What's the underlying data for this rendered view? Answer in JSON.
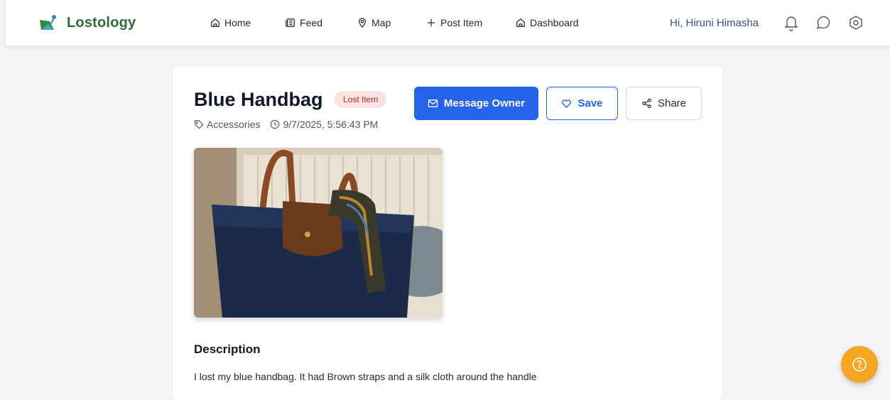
{
  "header": {
    "brand_name": "Lostology",
    "nav": {
      "home": "Home",
      "feed": "Feed",
      "map": "Map",
      "post_item": "Post Item",
      "dashboard": "Dashboard"
    },
    "greeting": "Hi, Hiruni Himasha",
    "icons": [
      "bell-icon",
      "chat-icon",
      "settings-icon"
    ]
  },
  "item": {
    "title": "Blue Handbag",
    "status_badge": "Lost Item",
    "category": "Accessories",
    "timestamp": "9/7/2025, 5:56:43 PM",
    "actions": {
      "message_owner": "Message Owner",
      "save": "Save",
      "share": "Share"
    },
    "photo_alt": "Blue Handbag",
    "description_heading": "Description",
    "description_text": "I lost my blue handbag. It had Brown straps and a silk cloth around the handle"
  },
  "colors": {
    "brand": "#2f6b3b",
    "primary": "#2563eb",
    "badge_bg": "#fde2e2",
    "badge_text": "#c02a2a",
    "help_fab": "#f5a623"
  }
}
